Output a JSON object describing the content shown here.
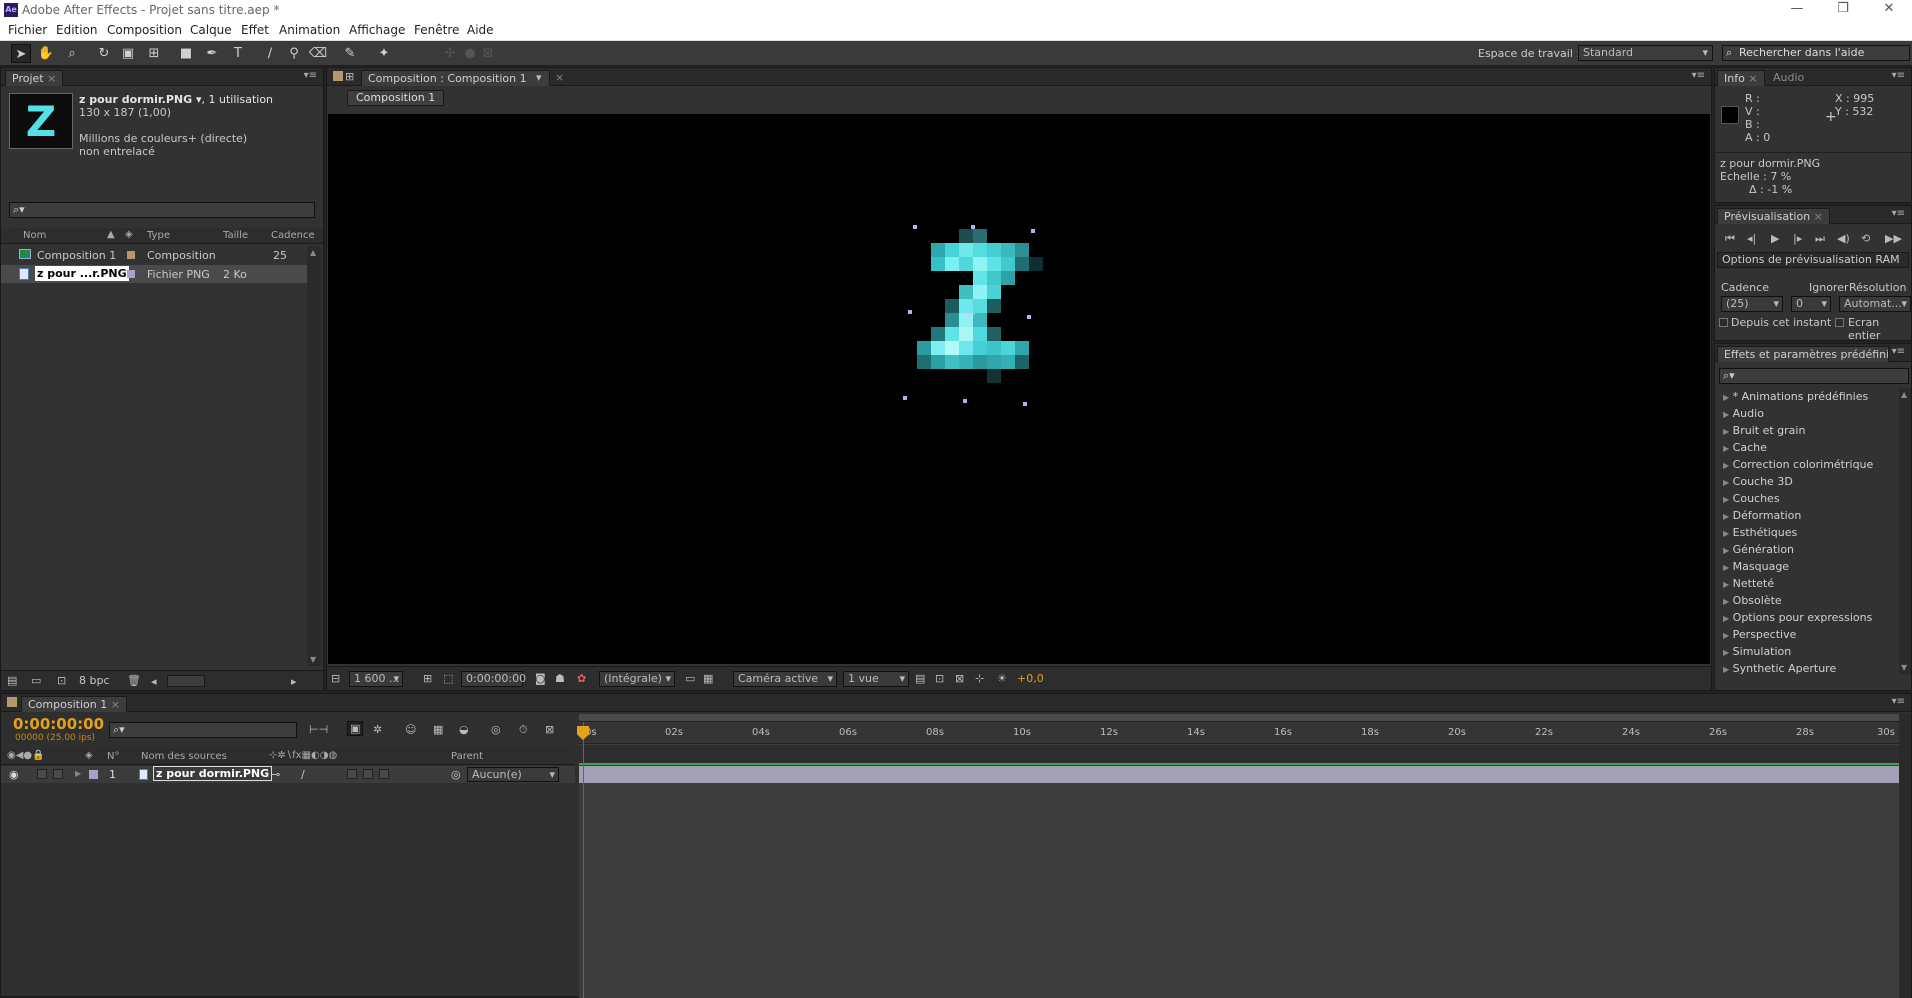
{
  "titlebar": {
    "app_icon": "Ae",
    "title": "Adobe After Effects - Projet sans titre.aep *"
  },
  "menu": [
    "Fichier",
    "Edition",
    "Composition",
    "Calque",
    "Effet",
    "Animation",
    "Affichage",
    "Fenêtre",
    "Aide"
  ],
  "workspace": {
    "label": "Espace de travail :",
    "value": "Standard",
    "help_placeholder": "Rechercher dans l'aide"
  },
  "project": {
    "tab": "Projet",
    "item_name": "z pour dormir.PNG ▾",
    "item_usage": ", 1 utilisation",
    "item_dims": "130 x 187 (1,00)",
    "item_colors": "Millions de couleurs+ (directe)",
    "item_interlace": "non entrelacé",
    "thumb_letter": "Z",
    "columns": [
      "Nom",
      "Type",
      "Taille",
      "Cadence"
    ],
    "rows": [
      {
        "name": "Composition 1",
        "type": "Composition",
        "size": "",
        "rate": "25"
      },
      {
        "name": "z pour ...r.PNG",
        "type": "Fichier PNG",
        "size": "2 Ko",
        "rate": ""
      }
    ],
    "bpc": "8 bpc"
  },
  "composition": {
    "tab": "Composition : Composition 1",
    "subtab": "Composition 1",
    "zoom": "1 600 ...",
    "timecode": "0:00:00:00",
    "resolution": "(Intégrale)",
    "camera": "Caméra active",
    "views": "1 vue",
    "exposure": "+0,0"
  },
  "info": {
    "tab": "Info",
    "tab2": "Audio",
    "r": "R :",
    "v": "V :",
    "b": "B :",
    "a": "A : 0",
    "x": "X : 995",
    "y": "Y : 532",
    "layer": "z pour dormir.PNG",
    "scale": "Echelle : 7 %",
    "delta": "Δ : -1 %"
  },
  "preview": {
    "tab": "Prévisualisation",
    "ram_options": "Options de prévisualisation RAM",
    "framerate_label": "Cadence",
    "skip_label": "Ignorer",
    "resolution_label": "Résolution",
    "framerate": "(25)",
    "skip": "0",
    "resolution": "Automat...",
    "from_current": "Depuis cet instant",
    "fullscreen": "Ecran entier"
  },
  "effects": {
    "tab": "Effets et paramètres prédéfinis",
    "items": [
      "* Animations prédéfinies",
      "Audio",
      "Bruit et grain",
      "Cache",
      "Correction colorimétrique",
      "Couche 3D",
      "Couches",
      "Déformation",
      "Esthétiques",
      "Génération",
      "Masquage",
      "Netteté",
      "Obsolète",
      "Options pour expressions",
      "Perspective",
      "Simulation",
      "Synthetic Aperture"
    ]
  },
  "timeline": {
    "tab": "Composition 1",
    "timecode": "0:00:00:00",
    "frame_info": "00000 (25.00 ips)",
    "col_num": "N°",
    "col_source": "Nom des sources",
    "col_parent": "Parent",
    "layer_num": "1",
    "layer_name": "z pour dormir.PNG",
    "parent": "Aucun(e)",
    "ruler": [
      "0s",
      "02s",
      "04s",
      "06s",
      "08s",
      "10s",
      "12s",
      "14s",
      "16s",
      "18s",
      "20s",
      "22s",
      "24s",
      "26s",
      "28s",
      "30s"
    ]
  },
  "colors": {
    "accent_orange": "#e3a21a",
    "teal_light": "#8ff3f3",
    "teal_mid": "#3fc9cf",
    "bar_purple": "#a39fb4"
  }
}
